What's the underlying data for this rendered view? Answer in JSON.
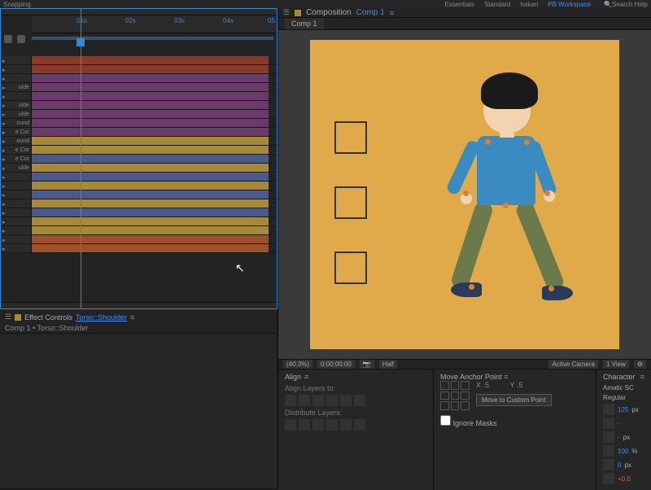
{
  "topbar": {
    "snapping": "Snapping",
    "workspaces": [
      "Essentials",
      "Standard",
      "hakan",
      "PB Workspace"
    ],
    "search": "Search Help",
    "active_ws": 3
  },
  "timeline": {
    "ticks": [
      "01s",
      "02s",
      "03s",
      "04s",
      "05"
    ],
    "layers": [
      {
        "label": "",
        "c": "c-red"
      },
      {
        "label": "",
        "c": "c-red"
      },
      {
        "label": "",
        "c": "c-pur"
      },
      {
        "label": "ulde",
        "c": "c-pur"
      },
      {
        "label": "",
        "c": "c-pur"
      },
      {
        "label": "ulde",
        "c": "c-pur"
      },
      {
        "label": "ulde",
        "c": "c-pur"
      },
      {
        "label": "ound",
        "c": "c-pur"
      },
      {
        "label": "e Cor",
        "c": "c-pur"
      },
      {
        "label": "ound",
        "c": "c-yel"
      },
      {
        "label": "e Cor",
        "c": "c-yel"
      },
      {
        "label": "e Cor",
        "c": "c-blu"
      },
      {
        "label": "ulde",
        "c": "c-yel"
      },
      {
        "label": "",
        "c": "c-blu"
      },
      {
        "label": "",
        "c": "c-yel"
      },
      {
        "label": "",
        "c": "c-blu"
      },
      {
        "label": "",
        "c": "c-yel"
      },
      {
        "label": "",
        "c": "c-blu"
      },
      {
        "label": "",
        "c": "c-yel"
      },
      {
        "label": "",
        "c": "c-yel"
      },
      {
        "label": "",
        "c": "c-ora"
      },
      {
        "label": "",
        "c": "c-ora"
      }
    ]
  },
  "effects": {
    "title": "Effect Controls",
    "layer": "Torso::Shoulder",
    "breadcrumb": "Comp 1 • Torso::Shoulder"
  },
  "composition": {
    "panel": "Composition",
    "name": "Comp 1",
    "tab": "Comp 1"
  },
  "viewer": {
    "zoom": "(40.3%)",
    "time": "0:00:00:00",
    "res": "Half",
    "camera": "Active Camera",
    "views": "1 View"
  },
  "align": {
    "title": "Align",
    "layers_to": "Align Layers to:",
    "distribute": "Distribute Layers:"
  },
  "anchor": {
    "title": "Move Anchor Point",
    "x_label": "X",
    "x": ".5",
    "y_label": "Y",
    "y": ".5",
    "custom": "Move to Custom Point",
    "ignore": "Ignore Masks"
  },
  "character": {
    "title": "Character",
    "font": "Amatic SC",
    "weight": "Regular",
    "size": "125",
    "size_unit": "px",
    "tracking": "-",
    "leading": "-",
    "leading_unit": "px",
    "scale": "100",
    "scale_unit": "%",
    "baseline": "0",
    "baseline_unit": "px",
    "fill": "+0,0"
  }
}
